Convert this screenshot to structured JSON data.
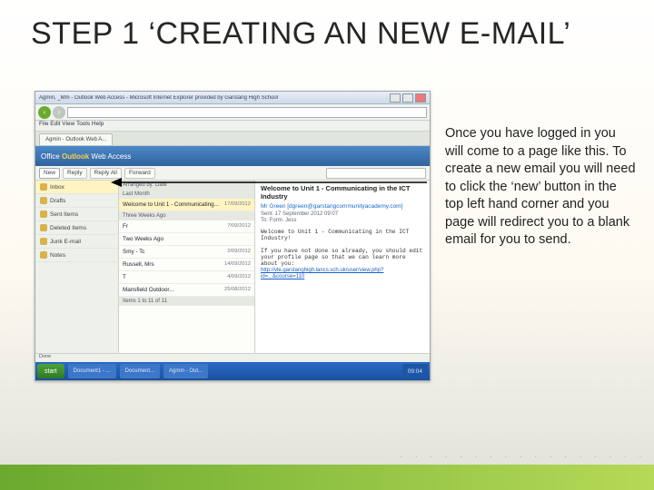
{
  "title": "STEP 1 ‘CREATING AN NEW E-MAIL’",
  "instruction": "Once you have logged in you will come to a page like this. To create a new email you will need to click the ‘new’ button in the top left hand corner and you page will redirect you to a blank email for you to send.",
  "window": {
    "title": "Agmin, _Mm - Outlook Web Access - Microsoft Internet Explorer provided by Garstang High School",
    "menubar": "File  Edit  View  Tools  Help",
    "tab": "Agmin - Outlook Web A..."
  },
  "owa": {
    "brand_prefix": "Office ",
    "brand_highlight": "Outlook",
    "brand_suffix": " Web Access",
    "toolbar": {
      "new": "New",
      "reply": "Reply",
      "reply_all": "Reply All",
      "forward": "Forward"
    },
    "nav": [
      "Inbox",
      "Drafts",
      "Sent Items",
      "Deleted Items",
      "Junk E-mail",
      "Notes"
    ],
    "list": {
      "arranged": "Arranged by: Date",
      "groups": [
        {
          "label": "Last Month",
          "messages": [
            {
              "sender": "Mr Green",
              "subject": "Welcome to Unit 1 - Communicating in the I...",
              "date": "17/09/2012",
              "selected": true
            }
          ]
        },
        {
          "label": "Three Weeks Ago",
          "messages": [
            {
              "sender": "Fr",
              "subject": "",
              "date": "7/09/2012"
            },
            {
              "sender": "Two Weeks Ago",
              "subject": "",
              "date": ""
            },
            {
              "sender": "Smy - Tc",
              "subject": "",
              "date": "2/09/2012"
            },
            {
              "sender": "Russell, Mrs",
              "subject": "",
              "date": "14/09/2012"
            },
            {
              "sender": "T",
              "subject": "",
              "date": "4/09/2012"
            },
            {
              "sender": "Mansfield Outdoor...",
              "subject": "",
              "date": "25/08/2012"
            }
          ]
        }
      ],
      "footer": "Items 1 to 11 of 11"
    },
    "preview": {
      "subject": "Welcome to Unit 1 - Communicating in the ICT Industry",
      "from": "Mr Green [dgreen@garstangcommunityacademy.com]",
      "sent": "Sent: 17 September 2012  09:07",
      "to": "To:   Form:  Jess",
      "body": "Welcome to Unit 1 - Communicating in the ICT Industry!\n\nIf you have not done so already, you should edit your profile page so that we can learn more about you:",
      "link": "http://vle.garstanghigh.lancs.sch.uk/user/view.php?id=...&course=110"
    }
  },
  "statusbar": "Done",
  "taskbar": {
    "start": "start",
    "items": [
      "Document1 - ...",
      "Document...",
      "Agmin - Out..."
    ],
    "clock": "09:04"
  }
}
